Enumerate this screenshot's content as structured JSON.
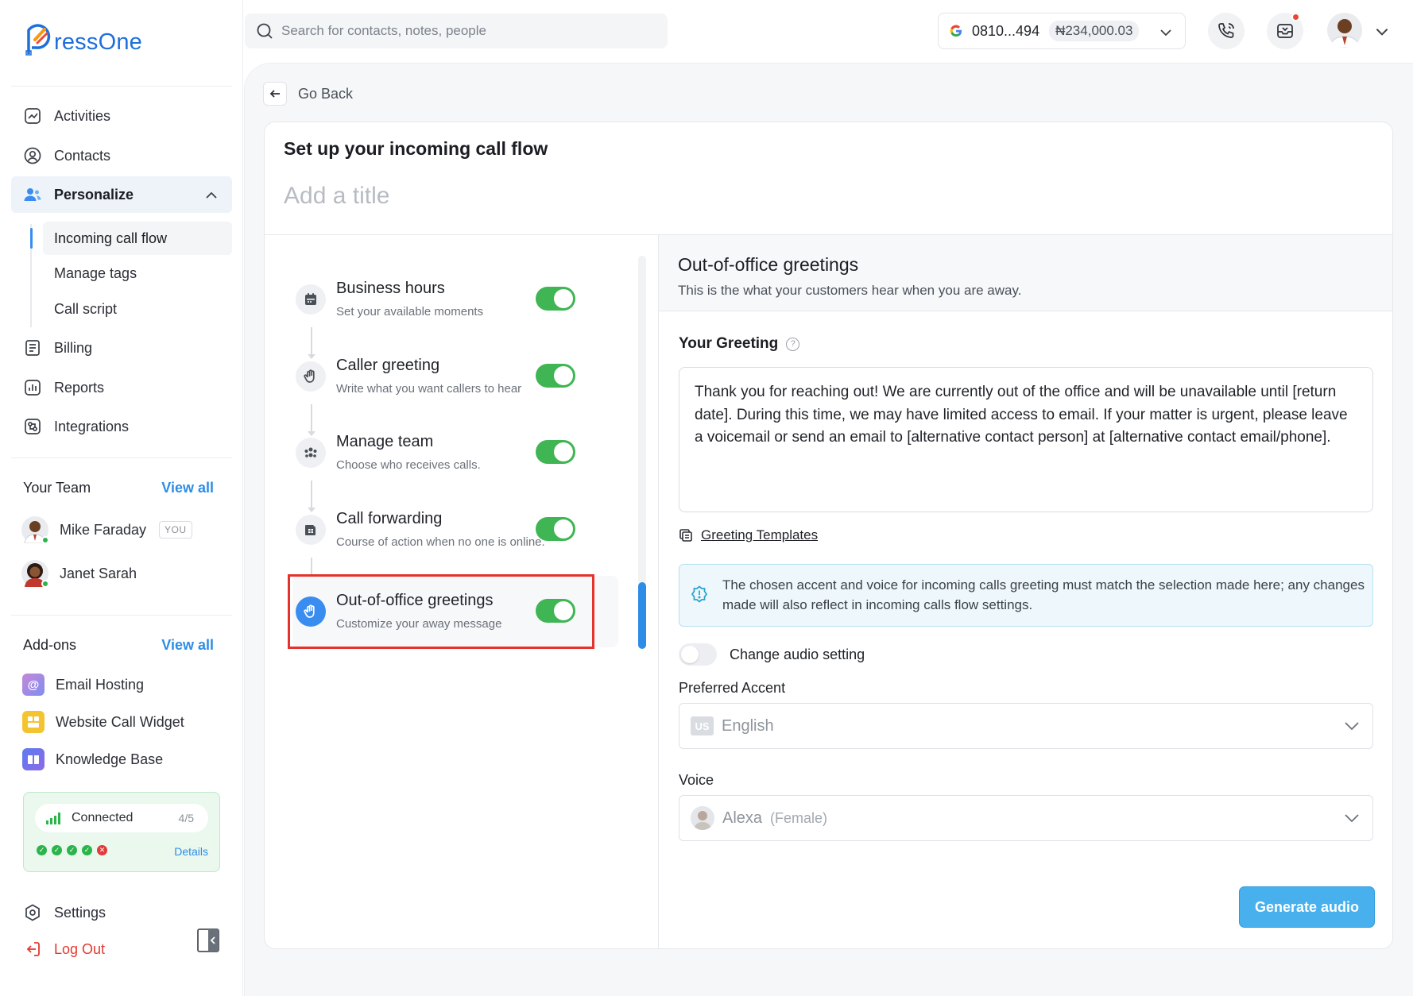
{
  "brand": {
    "name": "ressOne"
  },
  "search": {
    "placeholder": "Search for contacts, notes, people"
  },
  "account": {
    "number": "0810...494",
    "balance": "₦234,000.03"
  },
  "sidebar": {
    "nav": [
      {
        "label": "Activities",
        "icon": "activity-chart-icon"
      },
      {
        "label": "Contacts",
        "icon": "user-circle-icon"
      },
      {
        "label": "Personalize",
        "icon": "users-icon"
      }
    ],
    "sub": [
      {
        "label": "Incoming call flow"
      },
      {
        "label": "Manage tags"
      },
      {
        "label": "Call script"
      }
    ],
    "nav2": [
      {
        "label": "Billing",
        "icon": "receipt-icon"
      },
      {
        "label": "Reports",
        "icon": "bar-chart-icon"
      },
      {
        "label": "Integrations",
        "icon": "puzzle-icon"
      }
    ],
    "team": {
      "title": "Your Team",
      "view_all": "View all",
      "members": [
        {
          "name": "Mike Faraday",
          "badge": "YOU"
        },
        {
          "name": "Janet Sarah"
        }
      ]
    },
    "addons": {
      "title": "Add-ons",
      "view_all": "View all",
      "items": [
        {
          "label": "Email Hosting",
          "icon": "at-icon",
          "color": "#a67ed6"
        },
        {
          "label": "Website Call Widget",
          "icon": "widget-icon",
          "color": "#f4c430"
        },
        {
          "label": "Knowledge Base",
          "icon": "book-icon",
          "color": "#5b7cf0"
        }
      ]
    },
    "connection": {
      "label": "Connected",
      "count": "4/5",
      "details": "Details"
    },
    "settings": "Settings",
    "logout": "Log Out"
  },
  "main": {
    "go_back": "Go Back",
    "title": "Set up your incoming call flow",
    "title_placeholder": "Add a title",
    "steps": [
      {
        "title": "Business hours",
        "desc": "Set your available moments",
        "icon": "calendar-icon",
        "enabled": true
      },
      {
        "title": "Caller greeting",
        "desc": "Write what you want callers to hear",
        "icon": "wave-hand-icon",
        "enabled": true
      },
      {
        "title": "Manage team",
        "desc": "Choose who receives calls.",
        "icon": "team-icon",
        "enabled": true
      },
      {
        "title": "Call forwarding",
        "desc": "Course of action when no one is online.",
        "icon": "forward-icon",
        "enabled": true
      },
      {
        "title": "Out-of-office greetings",
        "desc": "Customize your away message",
        "icon": "wave-hand-icon",
        "enabled": true,
        "selected": true
      }
    ],
    "panel": {
      "title": "Out-of-office greetings",
      "subtitle": "This is the what your customers hear when you are away.",
      "greeting_label": "Your Greeting",
      "greeting_text": "Thank you for reaching out! We are currently out of the office and will be unavailable until [return date]. During this time, we may have limited access to email. If your matter is urgent, please leave a voicemail or send an email to [alternative contact person] at [alternative contact email/phone].",
      "templates_link": "Greeting Templates",
      "info": "The chosen accent and voice for incoming calls greeting must match the selection made here; any changes made will also reflect in incoming calls flow settings.",
      "audio_toggle_label": "Change audio setting",
      "audio_toggle_on": false,
      "accent_label": "Preferred Accent",
      "accent_flag": "US",
      "accent_value": "English",
      "voice_label": "Voice",
      "voice_value": "Alexa",
      "voice_gender": "(Female)",
      "generate_button": "Generate audio"
    }
  },
  "colors": {
    "accent": "#2d8de6",
    "toggle_on": "#3fb553",
    "highlight": "#e5322d"
  }
}
